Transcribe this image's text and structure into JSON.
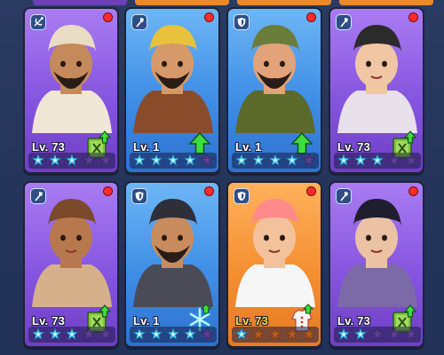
{
  "colors": {
    "purple": "#8655df",
    "blue": "#3f8ee6",
    "orange": "#f48f32",
    "notif": "#ff2a2a",
    "level_gold": "#ffd54a"
  },
  "cards": [
    {
      "level": "Lv. 73",
      "rarity": "purple",
      "class_icon": "crossbow-icon",
      "upgrade_icon": "upgrade-manual-icon",
      "stars_filled": 3,
      "stars_total": 5,
      "notification": true
    },
    {
      "level": "Lv. 1",
      "rarity": "blue",
      "class_icon": "staff-icon",
      "upgrade_icon": "green-arrow-icon",
      "stars_filled": 4,
      "stars_total": 5,
      "notification": true
    },
    {
      "level": "Lv. 1",
      "rarity": "blue",
      "class_icon": "shield-icon",
      "upgrade_icon": "green-arrow-icon",
      "stars_filled": 4,
      "stars_total": 5,
      "notification": true
    },
    {
      "level": "Lv. 73",
      "rarity": "purple",
      "class_icon": "staff-icon",
      "upgrade_icon": "upgrade-manual-icon",
      "stars_filled": 3,
      "stars_total": 5,
      "notification": true
    },
    {
      "level": "Lv. 73",
      "rarity": "purple",
      "class_icon": "staff-icon",
      "upgrade_icon": "upgrade-manual-icon",
      "stars_filled": 3,
      "stars_total": 5,
      "notification": true
    },
    {
      "level": "Lv. 1",
      "rarity": "blue",
      "class_icon": "shield-icon",
      "upgrade_icon": "snowflake-shard-icon",
      "stars_filled": 4,
      "stars_total": 5,
      "notification": true
    },
    {
      "level": "Lv. 73",
      "rarity": "orange",
      "class_icon": "shield-icon",
      "upgrade_icon": "outfit-icon",
      "stars_filled": 1,
      "stars_total": 5,
      "notification": true
    },
    {
      "level": "Lv. 73",
      "rarity": "purple",
      "class_icon": "staff-icon",
      "upgrade_icon": "upgrade-manual-icon",
      "stars_filled": 2,
      "stars_total": 5,
      "notification": true
    }
  ]
}
